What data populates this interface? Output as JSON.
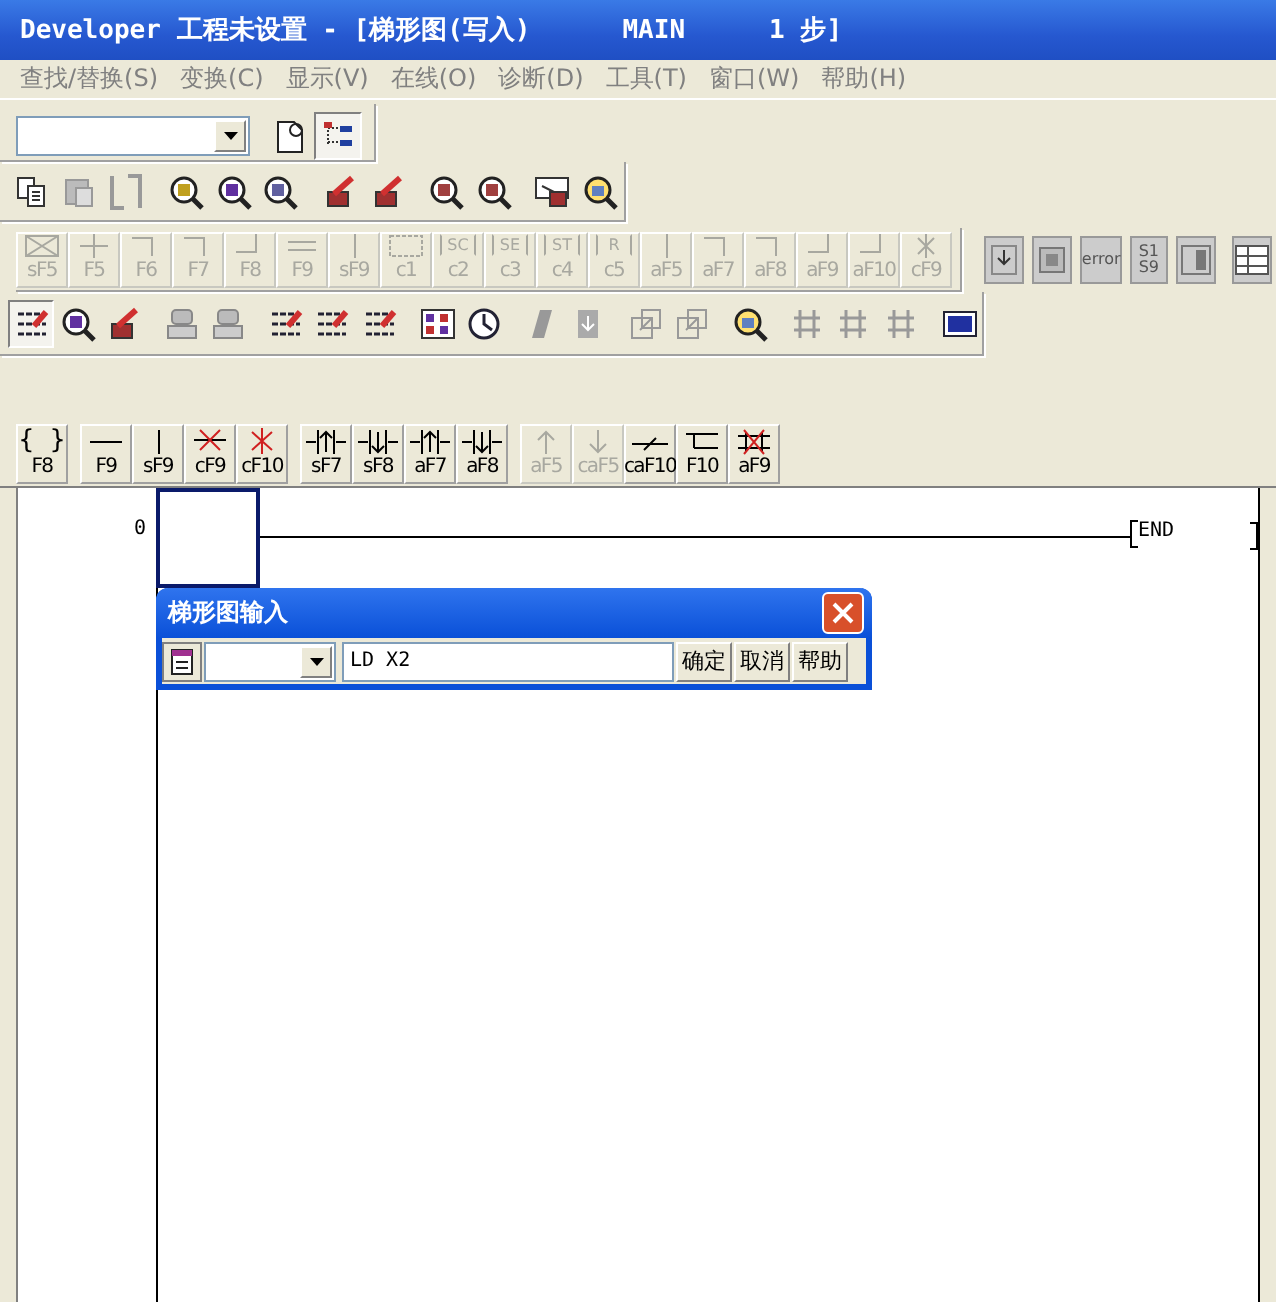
{
  "window": {
    "title": "Developer 工程未设置 - [梯形图(写入)",
    "program": "MAIN",
    "steps": "1 步]"
  },
  "menu": [
    "查找/替换(S)",
    "变换(C)",
    "显示(V)",
    "在线(O)",
    "诊断(D)",
    "工具(T)",
    "窗口(W)",
    "帮助(H)"
  ],
  "fkeys_top": [
    {
      "kind": "boxx",
      "key": "sF5",
      "disabled": true
    },
    {
      "kind": "plus",
      "key": "F5",
      "disabled": true
    },
    {
      "kind": "corner",
      "key": "F6",
      "disabled": true
    },
    {
      "kind": "corner",
      "key": "F7",
      "disabled": true
    },
    {
      "kind": "foot",
      "key": "F8",
      "disabled": true
    },
    {
      "kind": "double",
      "key": "F9",
      "disabled": true
    },
    {
      "kind": "vline",
      "key": "sF9",
      "disabled": true
    },
    {
      "kind": "dashbox",
      "key": "c1",
      "disabled": true
    },
    {
      "kind": "tagbox",
      "tag": "SC",
      "key": "c2",
      "disabled": true
    },
    {
      "kind": "tagbox",
      "tag": "SE",
      "key": "c3",
      "disabled": true
    },
    {
      "kind": "tagbox",
      "tag": "ST",
      "key": "c4",
      "disabled": true
    },
    {
      "kind": "tagbox",
      "tag": "R",
      "key": "c5",
      "disabled": true
    },
    {
      "kind": "vline",
      "key": "aF5",
      "disabled": true
    },
    {
      "kind": "corner",
      "key": "aF7",
      "disabled": true
    },
    {
      "kind": "corner",
      "key": "aF8",
      "disabled": true
    },
    {
      "kind": "foot",
      "key": "aF9",
      "disabled": true
    },
    {
      "kind": "foot",
      "key": "aF10",
      "disabled": true
    },
    {
      "kind": "xline",
      "key": "cF9",
      "disabled": true
    }
  ],
  "error_icon_text": "error",
  "device_icon_text": [
    "S1",
    "S9"
  ],
  "fkeys_bottom": [
    {
      "kind": "braces",
      "symbol": "{ }",
      "key": "F8",
      "disabled": false
    },
    {
      "kind": "hline",
      "key": "F9",
      "disabled": false
    },
    {
      "kind": "vline",
      "key": "sF9",
      "disabled": false
    },
    {
      "kind": "xh",
      "key": "cF9",
      "disabled": false
    },
    {
      "kind": "xv",
      "key": "cF10",
      "disabled": false
    },
    {
      "kind": "rise",
      "key": "sF7",
      "disabled": false
    },
    {
      "kind": "fall",
      "key": "sF8",
      "disabled": false
    },
    {
      "kind": "rise",
      "key": "aF7",
      "disabled": false
    },
    {
      "kind": "fall",
      "key": "aF8",
      "disabled": false
    },
    {
      "kind": "up",
      "key": "aF5",
      "disabled": true
    },
    {
      "kind": "down",
      "key": "caF5",
      "disabled": true
    },
    {
      "kind": "invert",
      "key": "caF10",
      "disabled": false
    },
    {
      "kind": "tee",
      "key": "F10",
      "disabled": false
    },
    {
      "kind": "xbox",
      "key": "aF9",
      "disabled": false
    }
  ],
  "ladder": {
    "step": "0",
    "end": "END"
  },
  "dialog": {
    "title": "梯形图输入",
    "instruction": "LD X2",
    "buttons": [
      "确定",
      "取消",
      "帮助"
    ]
  }
}
